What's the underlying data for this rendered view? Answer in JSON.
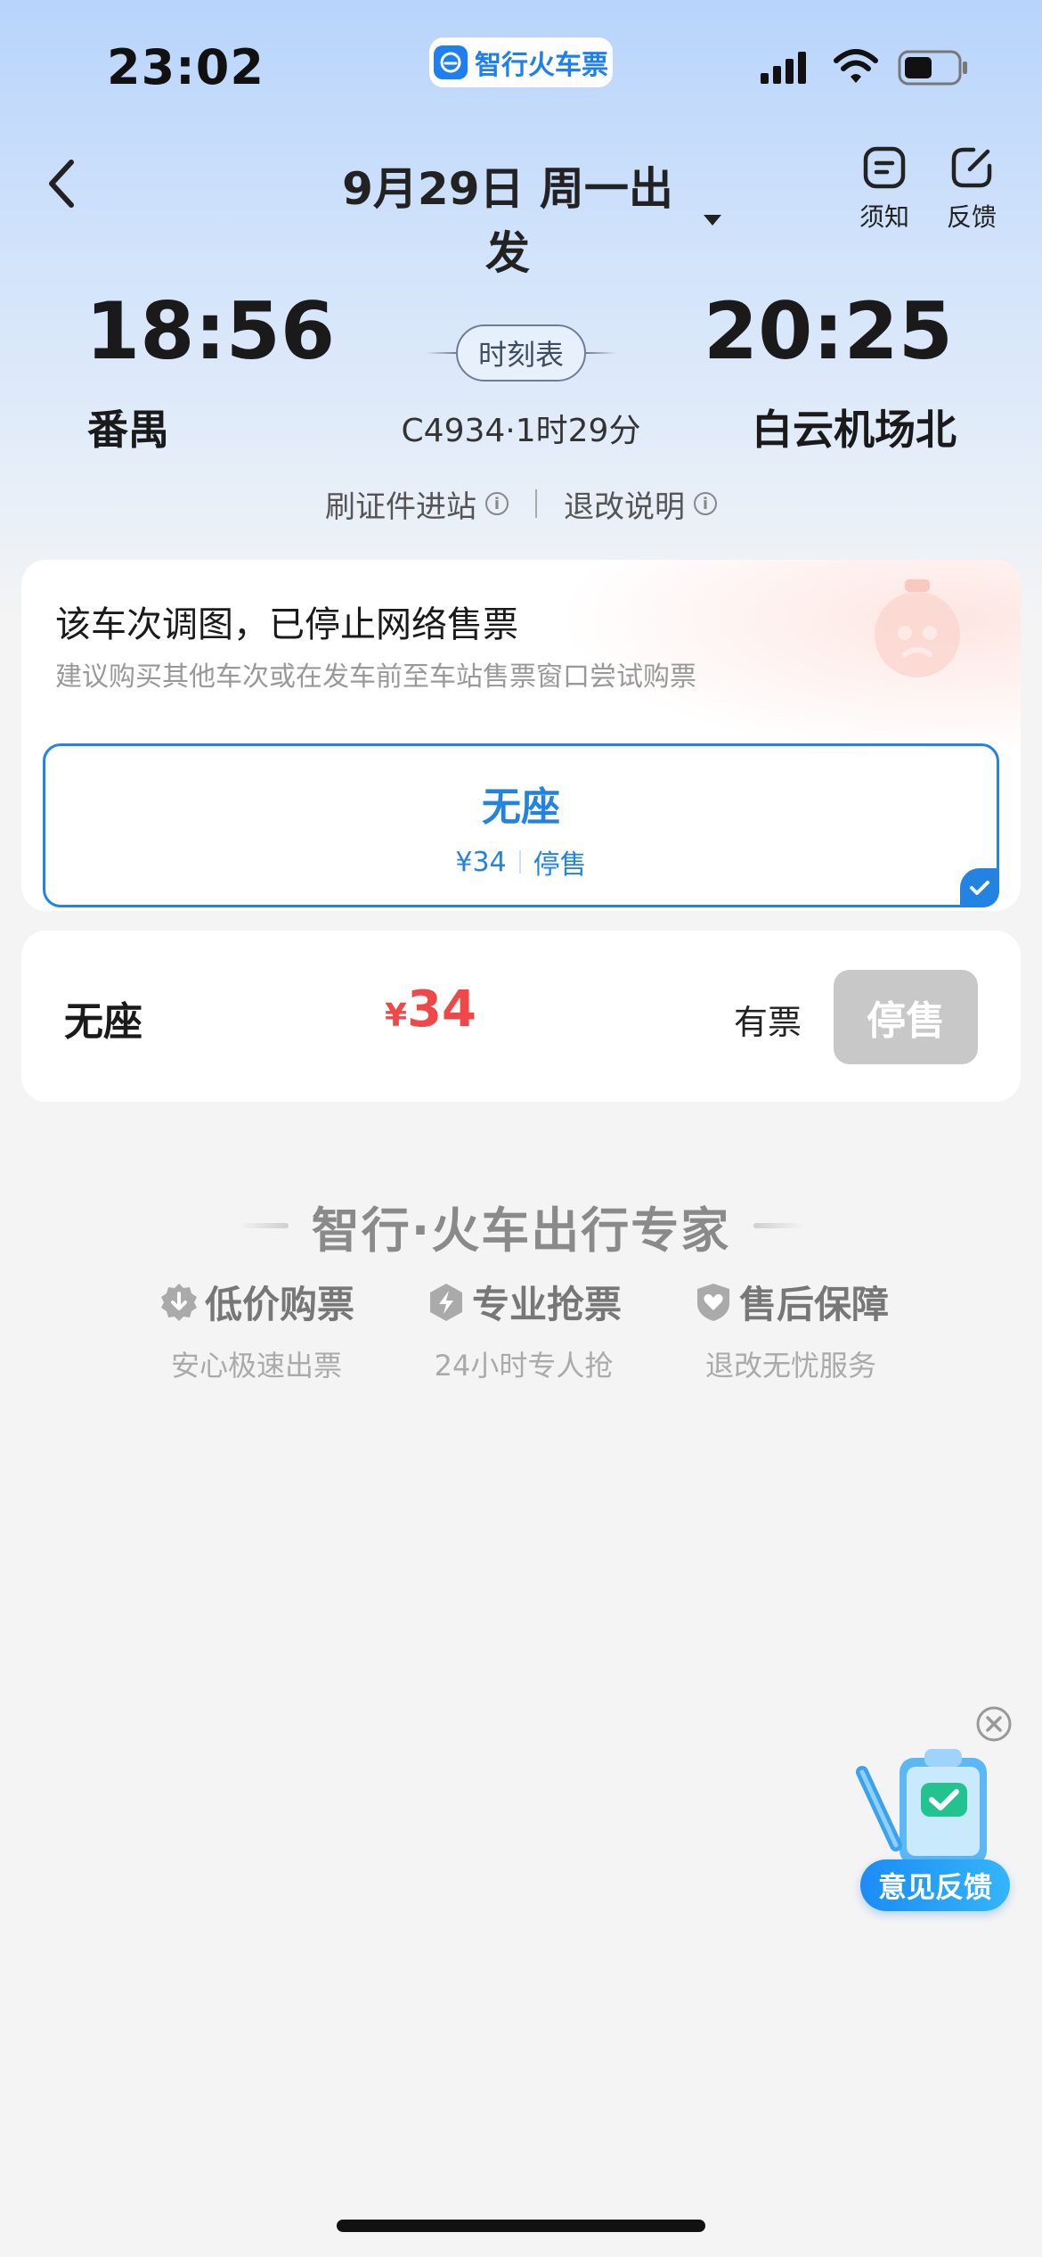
{
  "status_bar": {
    "time": "23:02",
    "app_badge": "智行火车票"
  },
  "nav": {
    "title": "9月29日 周一出发",
    "notice_label": "须知",
    "feedback_label": "反馈"
  },
  "journey": {
    "departure_time": "18:56",
    "departure_station": "番禺",
    "arrival_time": "20:25",
    "arrival_station": "白云机场北",
    "schedule_label": "时刻表",
    "train_info": "C4934·1时29分",
    "links": {
      "id_entry": "刷证件进站",
      "refund_info": "退改说明"
    }
  },
  "notice": {
    "title": "该车次调图，已停止网络售票",
    "subtitle": "建议购买其他车次或在发车前至车站售票窗口尝试购票",
    "selected_seat": {
      "name": "无座",
      "price": "¥34",
      "status": "停售"
    }
  },
  "seat_row": {
    "name": "无座",
    "currency": "¥",
    "price": "34",
    "availability": "有票",
    "button": "停售"
  },
  "brand": {
    "title": "智行·火车出行专家",
    "features": [
      {
        "title": "低价购票",
        "desc": "安心极速出票",
        "icon": "download-badge-icon"
      },
      {
        "title": "专业抢票",
        "desc": "24小时专人抢",
        "icon": "lightning-shield-icon"
      },
      {
        "title": "售后保障",
        "desc": "退改无忧服务",
        "icon": "heart-shield-icon"
      }
    ]
  },
  "float_feedback": {
    "label": "意见反馈"
  },
  "colors": {
    "accent": "#2383e2",
    "price_red": "#f04848",
    "disabled_gray": "#c8c8c8"
  }
}
